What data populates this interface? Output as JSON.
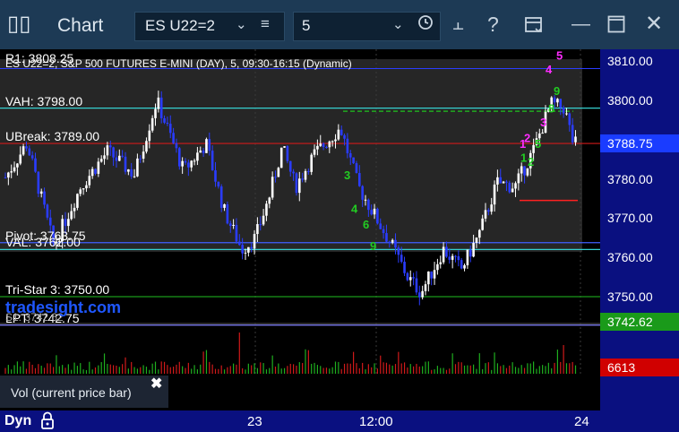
{
  "window": {
    "icon": "chart-app-icon",
    "title": "Chart"
  },
  "toolbar": {
    "symbol": "ES U22=2",
    "period": "5",
    "icons": [
      "chevron-down-icon",
      "menu-icon",
      "clock-icon",
      "link-icon",
      "help-icon",
      "layout-icon",
      "minimize-icon",
      "maximize-icon",
      "close-icon"
    ]
  },
  "chart": {
    "title": "ES U22=2, S&P 500 FUTURES E-MINI (DAY), 5, 09:30-16:15 (Dynamic)",
    "r1_label": "R1: 3808.25",
    "watermark": "tradesight.com",
    "levels": [
      {
        "label": "VAH: 3798.00",
        "price": 3798.0,
        "color": "#35d0d0"
      },
      {
        "label": "UBreak: 3789.00",
        "price": 3789.0,
        "color": "#d01a1a"
      },
      {
        "label": "Pivot: 3763.75",
        "price": 3763.75,
        "color": "#4060ff"
      },
      {
        "label": "VAL: 3762.00",
        "price": 3762.0,
        "color": "#35d0d0"
      },
      {
        "label": "Tri-Star 3: 3750.00",
        "price": 3750.0,
        "color": "#1a9a1a"
      },
      {
        "label": "LPT: 3742.75",
        "price": 3742.75,
        "color": "#8080ff"
      }
    ],
    "extra_label": "S1: 3742.62",
    "counts": [
      {
        "text": "5",
        "color": "#ff2cff",
        "price": 3811.5
      },
      {
        "text": "4",
        "color": "#ff2cff",
        "price": 3808.0
      },
      {
        "text": "3",
        "color": "#ff2cff",
        "price": 3794.5
      },
      {
        "text": "2",
        "color": "#ff2cff",
        "price": 3790.5
      },
      {
        "text": "1",
        "color": "#ff2cff",
        "price": 3789.0
      },
      {
        "text": "9",
        "color": "#22cc22",
        "price": 3802.5
      },
      {
        "text": "8",
        "color": "#22cc22",
        "price": 3798.0
      },
      {
        "text": "5",
        "color": "#22cc22",
        "price": 3789.0
      },
      {
        "text": "1",
        "color": "#22cc22",
        "price": 3785.5
      },
      {
        "text": "2",
        "color": "#22cc22",
        "price": 3784.5
      },
      {
        "text": "3",
        "color": "#22cc22",
        "price": 3781.0
      },
      {
        "text": "4",
        "color": "#22cc22",
        "price": 3772.5
      },
      {
        "text": "6",
        "color": "#22cc22",
        "price": 3768.5
      },
      {
        "text": "9",
        "color": "#22cc22",
        "price": 3763.0
      }
    ]
  },
  "price_axis": {
    "ticks": [
      "3810.00",
      "3800.00",
      "3790.00",
      "3780.00",
      "3770.00",
      "3760.00",
      "3750.00"
    ],
    "tick_values": [
      3810,
      3800,
      3790,
      3780,
      3770,
      3760,
      3750
    ],
    "current_price": "3788.75",
    "current_color": "#1a3cff",
    "s1_price": "3742.62",
    "s1_color": "#1a9a1a",
    "volume": "6613",
    "volume_color": "#d00000"
  },
  "volume_panel": {
    "label": "Vol (current price bar)"
  },
  "time_axis": {
    "labels": [
      "23",
      "12:00",
      "24"
    ]
  },
  "status": {
    "mode": "Dyn"
  }
}
